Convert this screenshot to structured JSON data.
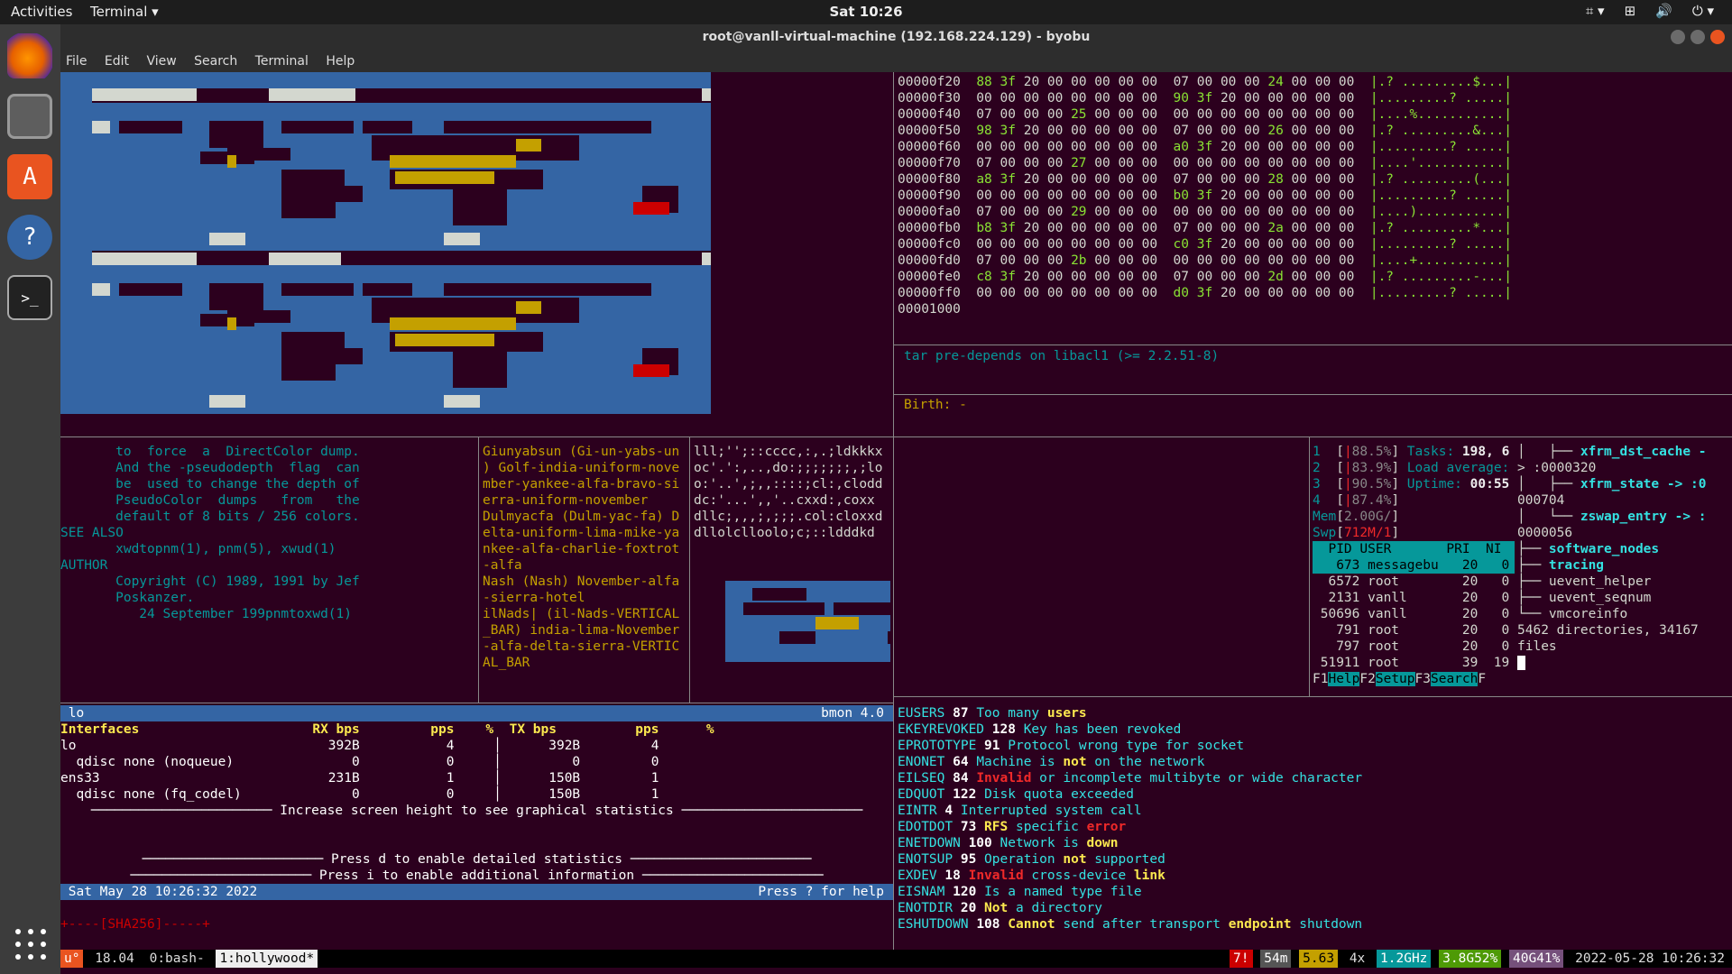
{
  "topbar": {
    "activities": "Activities",
    "app_menu": "Terminal ▾",
    "clock": "Sat 10:26",
    "tray": [
      "⌗ ▾",
      "⊞",
      "🔊",
      "⏻ ▾"
    ]
  },
  "window": {
    "title": "root@vanll-virtual-machine (192.168.224.129) - byobu",
    "menu": [
      "File",
      "Edit",
      "View",
      "Search",
      "Terminal",
      "Help"
    ]
  },
  "hexdump": [
    {
      "off": "00000f20",
      "bytes": "88 3f 20 00 00 00 00 00  07 00 00 00 24 00 00 00",
      "ascii": "|.? .........$...|"
    },
    {
      "off": "00000f30",
      "bytes": "00 00 00 00 00 00 00 00  90 3f 20 00 00 00 00 00",
      "ascii": "|.........? .....|"
    },
    {
      "off": "00000f40",
      "bytes": "07 00 00 00 25 00 00 00  00 00 00 00 00 00 00 00",
      "ascii": "|....%...........|"
    },
    {
      "off": "00000f50",
      "bytes": "98 3f 20 00 00 00 00 00  07 00 00 00 26 00 00 00",
      "ascii": "|.? .........&...|"
    },
    {
      "off": "00000f60",
      "bytes": "00 00 00 00 00 00 00 00  a0 3f 20 00 00 00 00 00",
      "ascii": "|.........? .....|"
    },
    {
      "off": "00000f70",
      "bytes": "07 00 00 00 27 00 00 00  00 00 00 00 00 00 00 00",
      "ascii": "|....'...........|"
    },
    {
      "off": "00000f80",
      "bytes": "a8 3f 20 00 00 00 00 00  07 00 00 00 28 00 00 00",
      "ascii": "|.? .........(...|"
    },
    {
      "off": "00000f90",
      "bytes": "00 00 00 00 00 00 00 00  b0 3f 20 00 00 00 00 00",
      "ascii": "|.........? .....|"
    },
    {
      "off": "00000fa0",
      "bytes": "07 00 00 00 29 00 00 00  00 00 00 00 00 00 00 00",
      "ascii": "|....)...........|"
    },
    {
      "off": "00000fb0",
      "bytes": "b8 3f 20 00 00 00 00 00  07 00 00 00 2a 00 00 00",
      "ascii": "|.? .........*...|"
    },
    {
      "off": "00000fc0",
      "bytes": "00 00 00 00 00 00 00 00  c0 3f 20 00 00 00 00 00",
      "ascii": "|.........? .....|"
    },
    {
      "off": "00000fd0",
      "bytes": "07 00 00 00 2b 00 00 00  00 00 00 00 00 00 00 00",
      "ascii": "|....+...........|"
    },
    {
      "off": "00000fe0",
      "bytes": "c8 3f 20 00 00 00 00 00  07 00 00 00 2d 00 00 00",
      "ascii": "|.? .........-...|"
    },
    {
      "off": "00000ff0",
      "bytes": "00 00 00 00 00 00 00 00  d0 3f 20 00 00 00 00 00",
      "ascii": "|.........? .....|"
    }
  ],
  "hexdump_end": "00001000",
  "apt_line": "tar pre-depends on libacl1 (>= 2.2.51-8)",
  "birth_line": "Birth: -",
  "manpage": {
    "lines": [
      "       to  force  a  DirectColor dump.",
      "       And the -pseudodepth  flag  can",
      "       be  used to change the depth of",
      "       PseudoColor  dumps   from   the",
      "       default of 8 bits / 256 colors.",
      "",
      "SEE ALSO",
      "       xwdtopnm(1), pnm(5), xwud(1)",
      "",
      "AUTHOR",
      "       Copyright (C) 1989, 1991 by Jef",
      "       Poskanzer.",
      "",
      "          24 September 199pnmtoxwd(1)"
    ]
  },
  "nato": {
    "lines": [
      "Giunyabsun (Gi-un-yabs-un",
      ") Golf-india-uniform-nove",
      "mber-yankee-alfa-bravo-si",
      "erra-uniform-november",
      "Dulmyacfa (Dulm-yac-fa) D",
      "elta-uniform-lima-mike-ya",
      "nkee-alfa-charlie-foxtrot",
      "-alfa",
      "Nash (Nash) November-alfa",
      "-sierra-hotel",
      "ilNads| (il-Nads-VERTICAL",
      "_BAR) india-lima-November",
      "-alfa-delta-sierra-VERTIC",
      "AL_BAR"
    ]
  },
  "smallascii": {
    "lines": [
      "lll;'';::cccc,:,.;ldkkkx",
      "oc'.':,..,do:;;;;;;;,;lo",
      "o:'..',;,,::::;cl:,clodd",
      "dc:'...',,'..cxxd:,coxx",
      "dllc;,,,;,;;;.col:cloxxd",
      "dllolclloolo;c;::ldddkd"
    ]
  },
  "htop": {
    "cpus": [
      {
        "n": "1",
        "pct": "88.5%"
      },
      {
        "n": "2",
        "pct": "83.9%"
      },
      {
        "n": "3",
        "pct": "90.5%"
      },
      {
        "n": "4",
        "pct": "87.4%"
      }
    ],
    "tasks_label": "Tasks:",
    "tasks_val": "198, 6",
    "load_label": "Load average:",
    "uptime_label": "Uptime:",
    "uptime_val": "00:55",
    "mem": "2.00G/",
    "swp": "712M/1",
    "header": "  PID USER       PRI  NI",
    "rows": [
      {
        "pid": "673",
        "user": "messagebu",
        "pri": "20",
        "ni": "0",
        "sel": true
      },
      {
        "pid": "6572",
        "user": "root",
        "pri": "20",
        "ni": "0"
      },
      {
        "pid": "2131",
        "user": "vanll",
        "pri": "20",
        "ni": "0"
      },
      {
        "pid": "50696",
        "user": "vanll",
        "pri": "20",
        "ni": "0"
      },
      {
        "pid": "791",
        "user": "root",
        "pri": "20",
        "ni": "0"
      },
      {
        "pid": "797",
        "user": "root",
        "pri": "20",
        "ni": "0"
      },
      {
        "pid": "51911",
        "user": "root",
        "pri": "39",
        "ni": "19"
      }
    ],
    "fkeys": [
      {
        "k": "F1",
        "l": "Help"
      },
      {
        "k": "F2",
        "l": "Setup"
      },
      {
        "k": "F3",
        "l": "Search"
      },
      {
        "k": "F",
        "l": ""
      }
    ]
  },
  "tree": {
    "lines": [
      {
        "t": "│   ├── ",
        "b": "xfrm_dst_cache -"
      },
      {
        "t": "> :0000320",
        "b": ""
      },
      {
        "t": "│   ├── ",
        "b": "xfrm_state -> :0"
      },
      {
        "t": "000704",
        "b": ""
      },
      {
        "t": "│   └── ",
        "b": "zswap_entry -> :"
      },
      {
        "t": "0000056",
        "b": ""
      },
      {
        "t": "├── ",
        "b": "software_nodes"
      },
      {
        "t": "├── ",
        "b": "tracing"
      },
      {
        "t": "├── uevent_helper",
        "b": ""
      },
      {
        "t": "├── uevent_seqnum",
        "b": ""
      },
      {
        "t": "└── vmcoreinfo",
        "b": ""
      },
      {
        "t": "",
        "b": ""
      },
      {
        "t": "5462 directories, 34167",
        "b": ""
      },
      {
        "t": "files",
        "b": ""
      }
    ]
  },
  "bmon": {
    "iface": "lo",
    "version": "bmon 4.0",
    "header": {
      "col": "Interfaces",
      "rx_bps": "RX bps",
      "rx_pps": "pps",
      "rx_pct": "%",
      "tx_bps": "TX bps",
      "tx_pps": "pps",
      "tx_pct": "%"
    },
    "rows": [
      {
        "name": "lo",
        "rx_bps": "392B",
        "rx_pps": "4",
        "tx_bps": "392B",
        "tx_pps": "4",
        "sel": true
      },
      {
        "name": "  qdisc none (noqueue)",
        "rx_bps": "0",
        "rx_pps": "0",
        "tx_bps": "0",
        "tx_pps": "0"
      },
      {
        "name": "ens33",
        "rx_bps": "231B",
        "rx_pps": "1",
        "tx_bps": "150B",
        "tx_pps": "1"
      },
      {
        "name": "  qdisc none (fq_codel)",
        "rx_bps": "0",
        "rx_pps": "0",
        "tx_bps": "150B",
        "tx_pps": "1"
      }
    ],
    "msg_graph": "Increase screen height to see graphical statistics",
    "msg_d": "Press d to enable detailed statistics",
    "msg_i": "Press i to enable additional information",
    "date": "Sat May 28 10:26:32 2022",
    "help": "Press ? for help"
  },
  "sha_line": "+----[SHA256]-----+",
  "errors": [
    {
      "name": "EUSERS",
      "num": "87",
      "desc": [
        [
          "Too many ",
          ""
        ],
        [
          "users",
          "y"
        ]
      ]
    },
    {
      "name": "EKEYREVOKED",
      "num": "128",
      "desc": [
        [
          "Key has been revoked",
          ""
        ]
      ]
    },
    {
      "name": "EPROTOTYPE",
      "num": "91",
      "desc": [
        [
          "Protocol wrong type for socket",
          ""
        ]
      ]
    },
    {
      "name": "ENONET",
      "num": "64",
      "desc": [
        [
          "Machine is ",
          ""
        ],
        [
          "not",
          "y"
        ],
        [
          " on the network",
          ""
        ]
      ]
    },
    {
      "name": "EILSEQ",
      "num": "84",
      "desc": [
        [
          "Invalid",
          "r"
        ],
        [
          " or incomplete multibyte or wide character",
          ""
        ]
      ]
    },
    {
      "name": "EDQUOT",
      "num": "122",
      "desc": [
        [
          "Disk quota exceeded",
          ""
        ]
      ]
    },
    {
      "name": "EINTR",
      "num": "4",
      "desc": [
        [
          "Interrupted system call",
          ""
        ]
      ]
    },
    {
      "name": "EDOTDOT",
      "num": "73",
      "desc": [
        [
          "RFS",
          "y"
        ],
        [
          " specific ",
          ""
        ],
        [
          "error",
          "r"
        ]
      ]
    },
    {
      "name": "ENETDOWN",
      "num": "100",
      "desc": [
        [
          "Network is ",
          ""
        ],
        [
          "down",
          "y"
        ]
      ]
    },
    {
      "name": "ENOTSUP",
      "num": "95",
      "desc": [
        [
          "Operation ",
          ""
        ],
        [
          "not",
          "y"
        ],
        [
          " supported",
          ""
        ]
      ]
    },
    {
      "name": "EXDEV",
      "num": "18",
      "desc": [
        [
          "Invalid",
          "r"
        ],
        [
          " cross-device ",
          ""
        ],
        [
          "link",
          "y"
        ]
      ]
    },
    {
      "name": "EISNAM",
      "num": "120",
      "desc": [
        [
          "Is a named type file",
          ""
        ]
      ]
    },
    {
      "name": "ENOTDIR",
      "num": "20",
      "desc": [
        [
          "Not",
          "y"
        ],
        [
          " a directory",
          ""
        ]
      ]
    },
    {
      "name": "ESHUTDOWN",
      "num": "108",
      "desc": [
        [
          "Cannot",
          "y"
        ],
        [
          " send after transport ",
          ""
        ],
        [
          "endpoint",
          "y"
        ],
        [
          " shutdown",
          ""
        ]
      ]
    }
  ],
  "status": {
    "logo": "u°",
    "release": "18.04",
    "win0": "0:bash-",
    "win1": "1:hollywood*",
    "alert": "7!",
    "uptime": "54m",
    "load": "5.63",
    "cpu": "4x",
    "ghz": "1.2GHz",
    "mem": "3.8G52%",
    "swap": "40G41%",
    "datetime": "2022-05-28 10:26:32"
  }
}
